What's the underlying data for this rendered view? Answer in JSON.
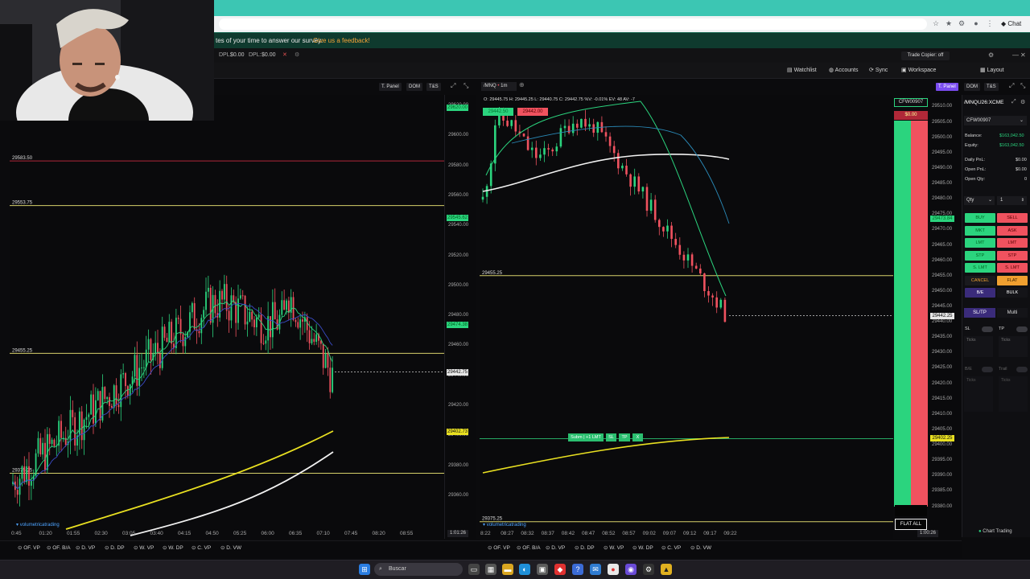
{
  "survey": {
    "text": "tes of your time to answer our survey:",
    "link": "Give us a feedback!"
  },
  "account_bar": {
    "dpl1_label": "DPL:",
    "dpl1_value": "$0.00",
    "dpl2_label": "DPL:",
    "dpl2_value": "$0.00"
  },
  "trade_copier": "Trade Copier: off",
  "toolbar": {
    "watchlist": "Watchlist",
    "accounts": "Accounts",
    "sync": "Sync",
    "workspace": "Workspace",
    "layout": "Layout"
  },
  "browser": {
    "chat_label": "Chat"
  },
  "left_chart": {
    "buttons": {
      "tpanel": "T. Panel",
      "dom": "DOM",
      "ts": "T&S"
    },
    "price_axis": [
      "29620.00",
      "29600.00",
      "29580.00",
      "29560.00",
      "29540.00",
      "29520.00",
      "29500.00",
      "29480.00",
      "29460.00",
      "29440.00",
      "29420.00",
      "29400.00",
      "29380.00",
      "29360.00"
    ],
    "hlines": [
      "29583.50",
      "29553.75",
      "29455.25",
      "29375.25"
    ],
    "tags": {
      "top": "29620.00",
      "mid1": "29545.62",
      "mid2": "29474.38",
      "last": "29442.75",
      "yellow": "29402.73"
    },
    "times": [
      "0:45",
      "01:20",
      "01:55",
      "02:30",
      "03:05",
      "03:40",
      "04:15",
      "04:50",
      "05:25",
      "06:00",
      "06:35",
      "07:10",
      "07:45",
      "08:20",
      "08:55"
    ],
    "timer": "1:01:26",
    "tabs": [
      "OF. VP",
      "OF. B/A",
      "D. VP",
      "D. DP",
      "W. VP",
      "W. DP",
      "C. VP",
      "D. VW"
    ],
    "watermark": "volumetricatrading"
  },
  "right_chart": {
    "symbol": "/MNQ",
    "interval": "1m",
    "ohlc": "O: 29445.75 H: 29445.25 L: 29440.75 C: 29442.75 %V: -0.01% EV: 48 AV: -7",
    "bid_tag": "29442.50",
    "ask_tag": "29442.00",
    "hlines": [
      "29455.25",
      "29375.25"
    ],
    "price_axis": [
      "29510.00",
      "29505.00",
      "29500.00",
      "29495.00",
      "29490.00",
      "29485.00",
      "29480.00",
      "29475.00",
      "29470.00",
      "29465.00",
      "29460.00",
      "29455.00",
      "29450.00",
      "29445.00",
      "29440.00",
      "29435.00",
      "29430.00",
      "29425.00",
      "29420.00",
      "29415.00",
      "29410.00",
      "29405.00",
      "29400.00",
      "29395.00",
      "29390.00",
      "29385.00",
      "29380.00"
    ],
    "tags": {
      "mid": "29473.84",
      "last": "29442.25",
      "yellow": "29402.25"
    },
    "order_pills": [
      "Subm | +1 LMT",
      "SL",
      "TP",
      "X"
    ],
    "times": [
      "8:22",
      "08:27",
      "08:32",
      "08:37",
      "08:42",
      "08:47",
      "08:52",
      "08:57",
      "09:02",
      "09:07",
      "09:12",
      "09:17",
      "09:22"
    ],
    "timer": "1:00:26",
    "tabs": [
      "OF. VP",
      "OF. B/A",
      "D. VP",
      "D. DP",
      "W. VP",
      "W. DP",
      "C. VP",
      "D. VW"
    ],
    "watermark": "volumetricatrading",
    "dom_account": "CFW00907",
    "dom_pnl": "$0.00",
    "flat_all": "FLAT ALL"
  },
  "trade_panel": {
    "symbol": "/MNQU26:XCME",
    "account": "CFW00907",
    "rows": [
      {
        "label": "Balance:",
        "value": "$163,042.50"
      },
      {
        "label": "Equity:",
        "value": "$163,042.50"
      },
      {
        "label": "Daily PnL:",
        "value": "$0.00"
      },
      {
        "label": "Open PnL:",
        "value": "$0.00"
      },
      {
        "label": "Open Qty:",
        "value": "0"
      }
    ],
    "qty_label": "Qty",
    "qty_value": "1",
    "buttons_left": [
      "BUY",
      "MKT",
      "LMT",
      "STP",
      "S. LMT",
      "CANCEL",
      "B/E"
    ],
    "buttons_right": [
      "SELL",
      "ASK",
      "LMT",
      "STP",
      "S. LMT",
      "FLAT",
      "BULK"
    ],
    "sltp": "SL/TP",
    "multi": "Multi",
    "sl": "SL",
    "tp": "TP",
    "ticks": "Ticks",
    "be": "B/E",
    "trail": "Trail",
    "chart_trading": "Chart Trading",
    "colors": {
      "buy": "#2bd47e",
      "sell": "#f0525f",
      "cancel_text": "#f0a030",
      "flat": "#f0a030",
      "purple": "#7a4cf0"
    }
  },
  "taskbar": {
    "search_placeholder": "Buscar"
  }
}
